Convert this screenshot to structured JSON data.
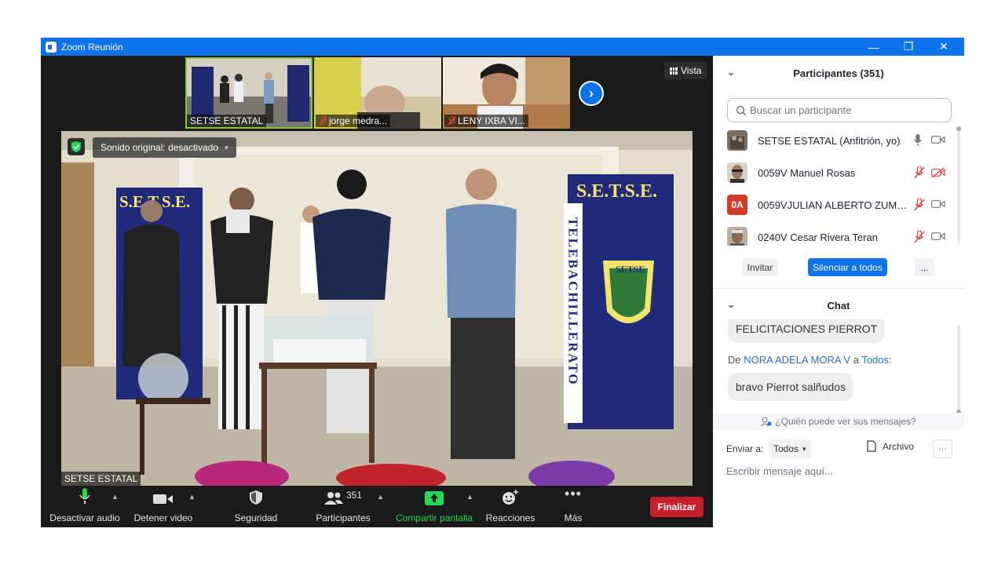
{
  "window": {
    "title": "Zoom Reunión",
    "controls": [
      "—",
      "❐",
      "✕"
    ]
  },
  "thumbnails": [
    {
      "name": "SETSE ESTATAL",
      "muted": false,
      "active": true
    },
    {
      "name": "jorge medra...",
      "muted": true,
      "active": false
    },
    {
      "name": "LENY IXBA VI...",
      "muted": true,
      "active": false
    }
  ],
  "view_button": {
    "label": "Vista"
  },
  "main_video": {
    "audio_status": "Sonido original: desactivado",
    "speaker_name": "SETSE ESTATAL",
    "banner_text_left": "S.E.T.S.E.",
    "banner_text_right": "S.E.T.S.E.",
    "banner_vertical": "TELEBACHILLERATO",
    "seal_text": "SETSE"
  },
  "toolbar": {
    "audio": "Desactivar audio",
    "video": "Detener video",
    "security": "Seguridad",
    "participants": "Participantes",
    "participants_count": "351",
    "share": "Compartir pantalla",
    "reactions": "Reacciones",
    "more": "Más",
    "end": "Finalizar"
  },
  "participants_panel": {
    "title": "Participantes (351)",
    "search_placeholder": "Buscar un participante",
    "participants": [
      {
        "name": "SETSE ESTATAL (Anfitrión, yo)",
        "initials": "",
        "mic_muted": false,
        "cam_off": false
      },
      {
        "name": "0059V Manuel Rosas",
        "initials": "",
        "mic_muted": true,
        "cam_off": true
      },
      {
        "name": "0059VJULIAN ALBERTO ZUMAYA...",
        "initials": "0A",
        "mic_muted": true,
        "cam_off": false
      },
      {
        "name": "0240V Cesar Rivera Teran",
        "initials": "",
        "mic_muted": true,
        "cam_off": false
      }
    ],
    "invite": "Invitar",
    "mute_all": "Silenciar a todos",
    "more": "..."
  },
  "chat_panel": {
    "title": "Chat",
    "messages": [
      {
        "text": "FELICITACIONES PIERROT"
      },
      {
        "text": "bravo  Pierrot salñudos"
      }
    ],
    "from_prefix": "De",
    "from_sender": "NORA ADELA MORA V",
    "from_mid": "a",
    "from_target": "Todos:",
    "who_can_see": "¿Quién puede ver sus mensajes?",
    "send_to_label": "Enviar a:",
    "send_to_value": "Todos",
    "file_label": "Archivo",
    "options": "···",
    "input_placeholder": "Escribir mensaje aquí..."
  },
  "colors": {
    "zoom_blue": "#0e72ed",
    "end_red": "#c8202a",
    "share_green": "#23d959",
    "muted_red": "#e0443b"
  }
}
